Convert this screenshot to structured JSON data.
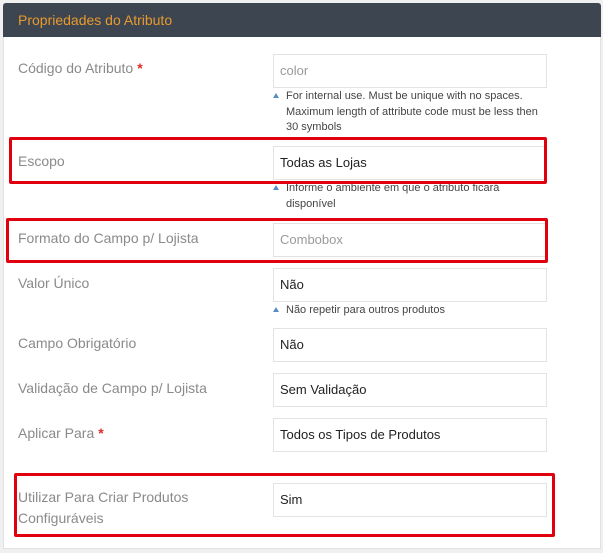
{
  "header": {
    "title": "Propriedades do Atributo"
  },
  "fields": {
    "codigo": {
      "label": "Código do Atributo",
      "required": "*",
      "placeholder": "color",
      "note": "For internal use. Must be unique with no spaces. Maximum length of attribute code must be less then 30 symbols"
    },
    "escopo": {
      "label": "Escopo",
      "value": "Todas as Lojas",
      "note": "Informe o ambiente em que o atributo ficará disponível"
    },
    "formato": {
      "label": "Formato do Campo p/ Lojista",
      "value": "Combobox"
    },
    "valor_unico": {
      "label": "Valor Único",
      "value": "Não",
      "note": "Não repetir para outros produtos"
    },
    "obrigatorio": {
      "label": "Campo Obrigatório",
      "value": "Não"
    },
    "validacao": {
      "label": "Validação de Campo p/ Lojista",
      "value": "Sem Validação"
    },
    "aplicar": {
      "label": "Aplicar Para",
      "required": "*",
      "value": "Todos os Tipos de Produtos"
    },
    "configuraveis": {
      "label": "Utilizar Para Criar Produtos Configuráveis",
      "value": "Sim"
    }
  },
  "colors": {
    "header_bg": "#3d4551",
    "header_text": "#e89a2c",
    "highlight": "#e0000e",
    "required": "#e02b27"
  }
}
